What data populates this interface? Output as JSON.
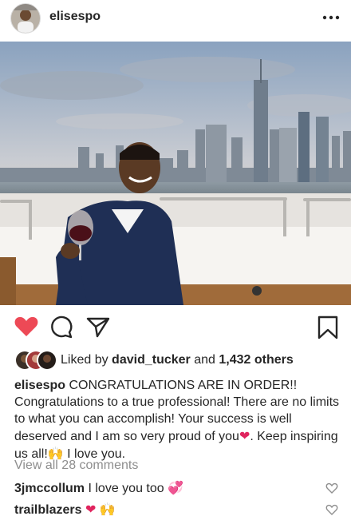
{
  "post": {
    "author": "elisespo",
    "more_icon": "more-dots-icon"
  },
  "actions": {
    "liked": true,
    "like_color": "#ed4956",
    "icons": [
      "heart-icon",
      "comment-icon",
      "share-icon",
      "bookmark-icon"
    ]
  },
  "likes": {
    "prefix": "Liked by",
    "user": "david_tucker",
    "conjunction": "and",
    "others": "1,432 others"
  },
  "caption": {
    "user": "elisespo",
    "text_part1": "CONGRATULATIONS ARE IN ORDER!! Congratulations to a true professional! There are no limits to what you can accomplish! Your success is well deserved and I am so very proud of you",
    "emoji_heart": "❤",
    "text_part2": ". Keep inspiring us all!",
    "emoji_hands": "🙌",
    "text_part3": " I love you."
  },
  "view_all": "View all 28 comments",
  "comments": [
    {
      "user": "3jmccollum",
      "text": "I love you too ",
      "emoji": "💞"
    },
    {
      "user": "trailblazers",
      "text": "",
      "emoji1": "❤",
      "emoji2": "🙌"
    }
  ]
}
